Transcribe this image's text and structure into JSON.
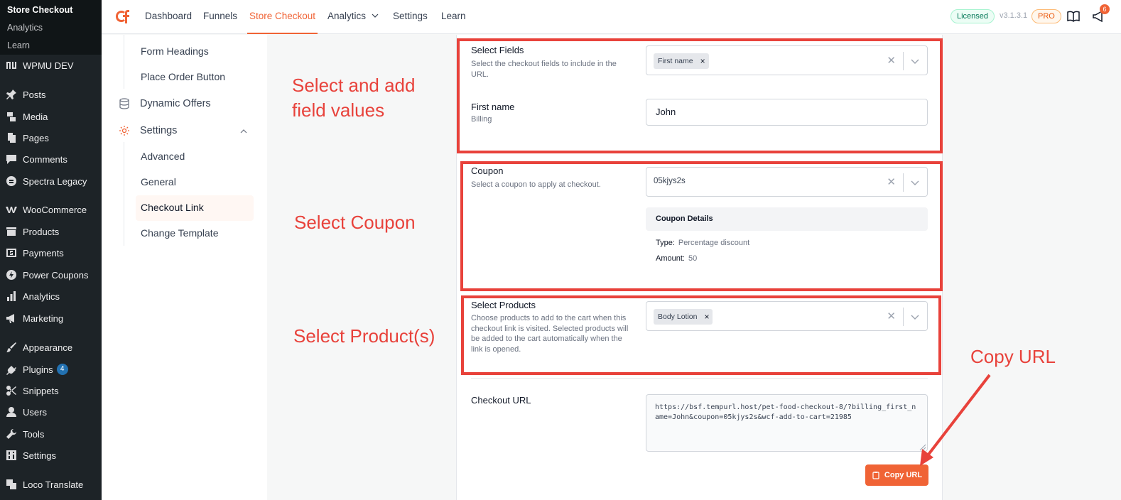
{
  "wp_sidebar": {
    "submenu": [
      "Store Checkout",
      "Analytics",
      "Learn"
    ],
    "items": [
      {
        "label": "WPMU DEV",
        "icon": "wpmudev-icon"
      },
      {
        "label": "Posts",
        "icon": "pin-icon"
      },
      {
        "label": "Media",
        "icon": "media-icon"
      },
      {
        "label": "Pages",
        "icon": "pages-icon"
      },
      {
        "label": "Comments",
        "icon": "comment-icon"
      },
      {
        "label": "Spectra Legacy",
        "icon": "spectra-icon"
      },
      {
        "label": "WooCommerce",
        "icon": "woo-icon"
      },
      {
        "label": "Products",
        "icon": "archive-icon"
      },
      {
        "label": "Payments",
        "icon": "payments-icon"
      },
      {
        "label": "Power Coupons",
        "icon": "bolt-icon"
      },
      {
        "label": "Analytics",
        "icon": "bar-chart-icon"
      },
      {
        "label": "Marketing",
        "icon": "megaphone-icon"
      },
      {
        "label": "Appearance",
        "icon": "brush-icon"
      },
      {
        "label": "Plugins",
        "icon": "plug-icon",
        "badge": "4"
      },
      {
        "label": "Snippets",
        "icon": "scissors-icon"
      },
      {
        "label": "Users",
        "icon": "user-icon"
      },
      {
        "label": "Tools",
        "icon": "wrench-icon"
      },
      {
        "label": "Settings",
        "icon": "sliders-icon"
      },
      {
        "label": "Loco Translate",
        "icon": "translate-icon"
      }
    ]
  },
  "topnav": {
    "links": [
      "Dashboard",
      "Funnels",
      "Store Checkout",
      "Analytics",
      "Settings",
      "Learn"
    ],
    "active": "Store Checkout",
    "licensed": "Licensed",
    "version": "v3.1.3.1",
    "pro": "PRO",
    "notification_count": "6"
  },
  "settings_menu": {
    "form_headings": "Form Headings",
    "place_order_button": "Place Order Button",
    "dynamic_offers": "Dynamic Offers",
    "settings": "Settings",
    "advanced": "Advanced",
    "general": "General",
    "checkout_link": "Checkout Link",
    "change_template": "Change Template"
  },
  "fields": {
    "title": "Select Fields",
    "desc": "Select the checkout fields to include in the URL.",
    "tag": "First name",
    "first_name_label": "First name",
    "first_name_sub": "Billing",
    "first_name_value": "John"
  },
  "coupon": {
    "title": "Coupon",
    "desc": "Select a coupon to apply at checkout.",
    "value": "05kjys2s",
    "details_title": "Coupon Details",
    "type_label": "Type:",
    "type_value": "Percentage discount",
    "amount_label": "Amount:",
    "amount_value": "50"
  },
  "products": {
    "title": "Select Products",
    "desc": "Choose products to add to the cart when this checkout link is visited. Selected products will be added to the cart automatically when the link is opened.",
    "tag": "Body Lotion"
  },
  "checkout_url": {
    "label": "Checkout URL",
    "value": "https://bsf.tempurl.host/pet-food-checkout-8/?billing_first_name=John&coupon=05kjys2s&wcf-add-to-cart=21985",
    "copy_button": "Copy URL"
  },
  "annotations": {
    "select_fields": "Select and add field values",
    "select_coupon": "Select Coupon",
    "select_products": "Select Product(s)",
    "copy_url": "Copy URL",
    "color": "#e8423b"
  }
}
